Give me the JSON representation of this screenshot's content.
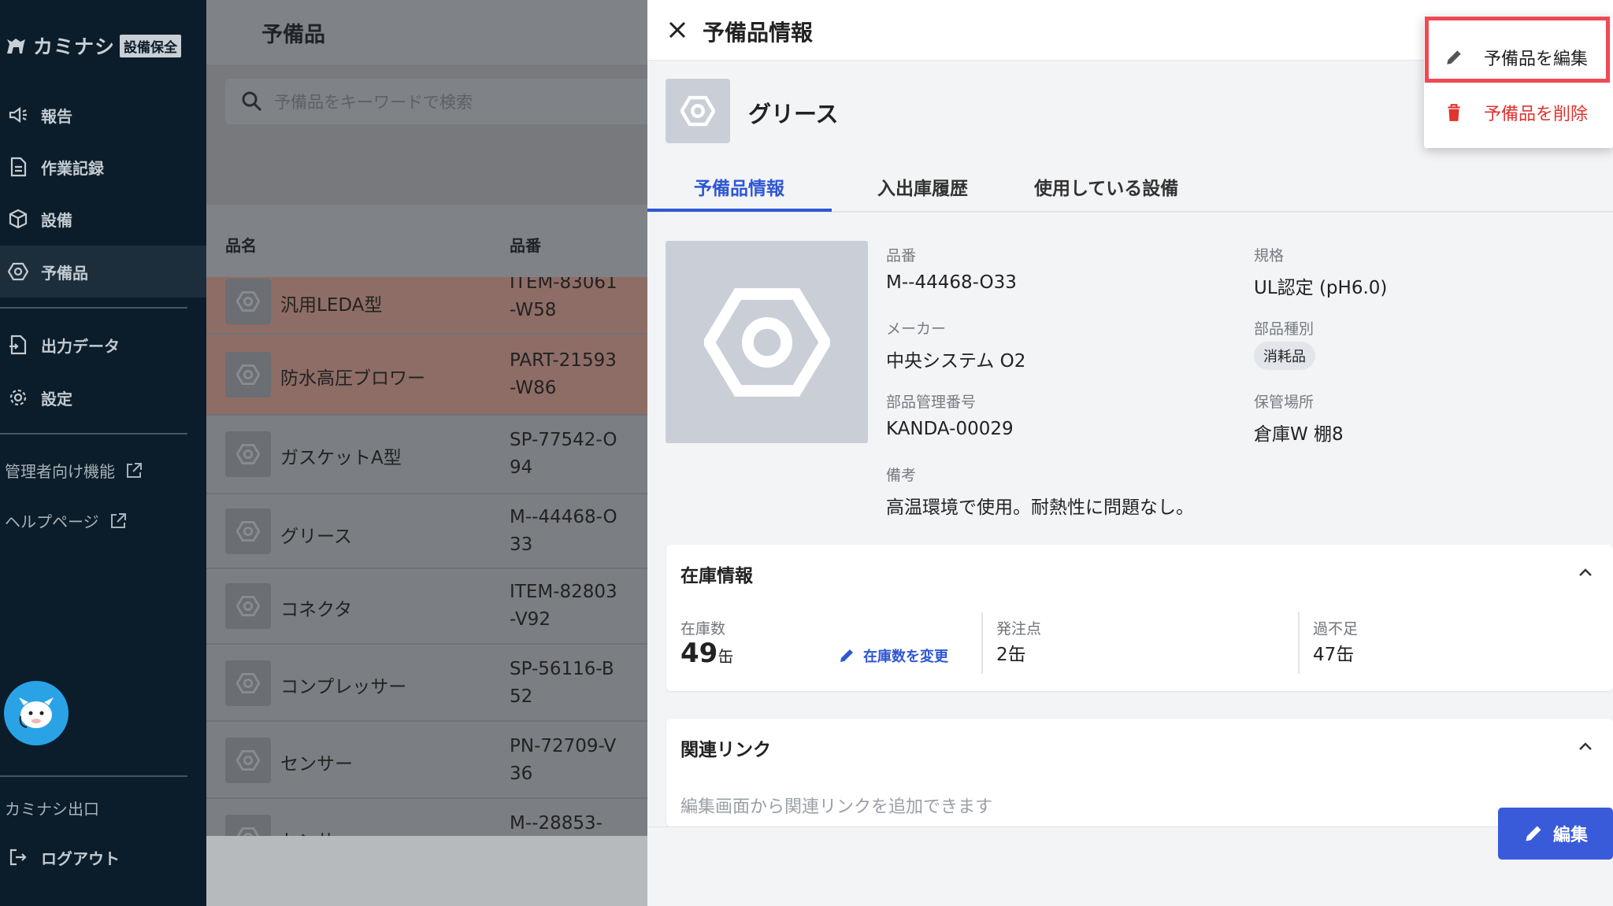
{
  "sidebar": {
    "brand": "カミナシ",
    "brand_badge": "設備保全",
    "nav": [
      {
        "label": "報告",
        "icon": "megaphone-icon"
      },
      {
        "label": "作業記録",
        "icon": "document-icon"
      },
      {
        "label": "設備",
        "icon": "cube-icon"
      },
      {
        "label": "予備品",
        "icon": "hex-nut-icon"
      },
      {
        "label": "出力データ",
        "icon": "export-file-icon"
      },
      {
        "label": "設定",
        "icon": "gear-icon"
      }
    ],
    "admin_link": "管理者向け機能",
    "help_link": "ヘルプページ",
    "exit_link": "カミナシ出口",
    "logout": "ログアウト"
  },
  "main": {
    "title": "予備品",
    "search_placeholder": "予備品をキーワードで検索",
    "columns": {
      "name": "品名",
      "code": "品番"
    },
    "rows": [
      {
        "name": "汎用LEDA型",
        "code": "ITEM-83061-W58",
        "warn": true
      },
      {
        "name": "防水高圧ブロワー",
        "code": "PART-21593-W86",
        "warn": true
      },
      {
        "name": "ガスケットA型",
        "code": "SP-77542-O94",
        "warn": false
      },
      {
        "name": "グリース",
        "code": "M--44468-O33",
        "warn": false
      },
      {
        "name": "コネクタ",
        "code": "ITEM-82803-V92",
        "warn": false
      },
      {
        "name": "コンプレッサー",
        "code": "SP-56116-B52",
        "warn": false
      },
      {
        "name": "センサー",
        "code": "PN-72709-V36",
        "warn": false
      },
      {
        "name": "センサー",
        "code": "M--28853-",
        "warn": false
      }
    ]
  },
  "drawer": {
    "title": "予備品情報",
    "item_name": "グリース",
    "tabs": [
      "予備品情報",
      "入出庫履歴",
      "使用している設備"
    ],
    "details": {
      "part_number_label": "品番",
      "part_number": "M--44468-O33",
      "spec_label": "規格",
      "spec": "UL認定 (pH6.0)",
      "maker_label": "メーカー",
      "maker": "中央システム O2",
      "part_type_label": "部品種別",
      "part_type": "消耗品",
      "mgmt_no_label": "部品管理番号",
      "mgmt_no": "KANDA-00029",
      "location_label": "保管場所",
      "location": "倉庫W 棚8",
      "note_label": "備考",
      "note": "高温環境で使用。耐熱性に問題なし。"
    },
    "stock": {
      "title": "在庫情報",
      "qty_label": "在庫数",
      "qty": "49",
      "qty_unit": "缶",
      "change_label": "在庫数を変更",
      "reorder_label": "発注点",
      "reorder": "2缶",
      "diff_label": "過不足",
      "diff": "47缶"
    },
    "links": {
      "title": "関連リンク",
      "empty": "編集画面から関連リンクを追加できます"
    },
    "edit_button": "編集"
  },
  "menu": {
    "edit": "予備品を編集",
    "delete": "予備品を削除"
  },
  "colors": {
    "sidebar_bg": "#0b1d2a",
    "accent": "#2f57d4",
    "danger": "#e1332f",
    "highlight": "#ee4a55"
  }
}
